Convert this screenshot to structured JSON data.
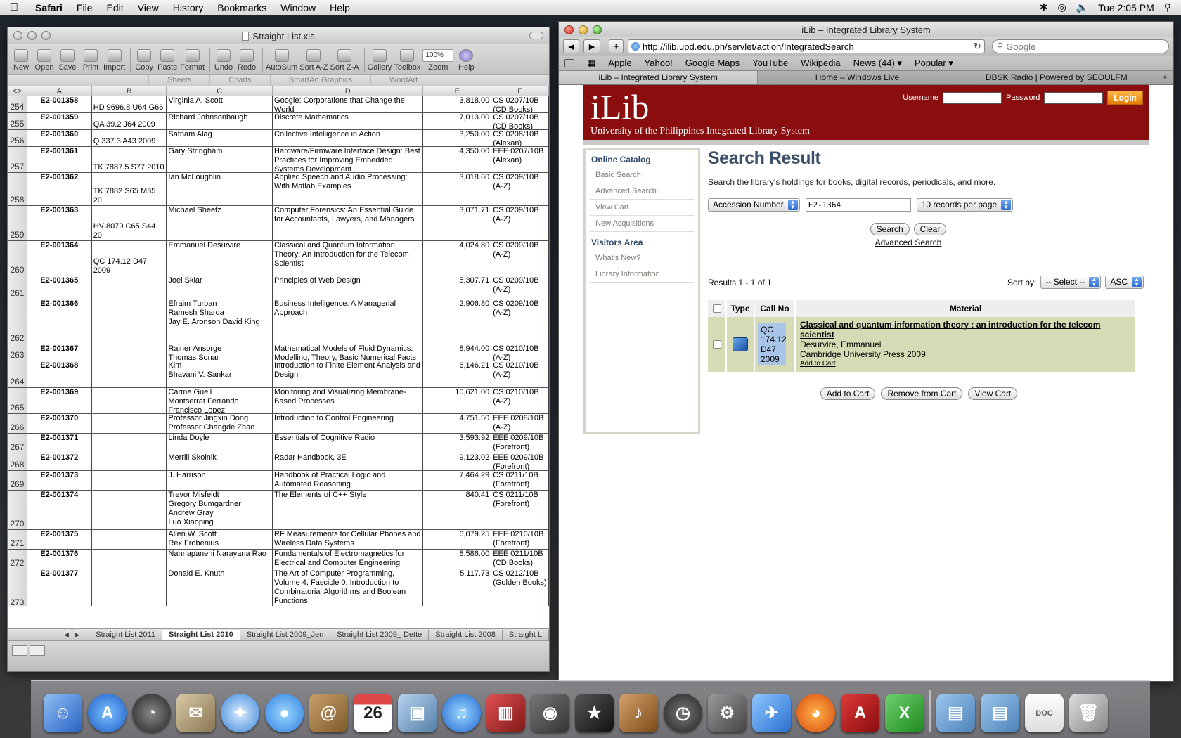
{
  "menubar": {
    "app": "Safari",
    "items": [
      "File",
      "Edit",
      "View",
      "History",
      "Bookmarks",
      "Window",
      "Help"
    ],
    "clock": "Tue 2:05 PM"
  },
  "excel": {
    "title": "Straight List.xls",
    "toolbar": [
      "New",
      "Open",
      "Save",
      "Print",
      "Import",
      "Copy",
      "Paste",
      "Format",
      "Undo",
      "Redo",
      "AutoSum",
      "Sort A-Z",
      "Sort Z-A",
      "Gallery",
      "Toolbox",
      "Zoom",
      "Help"
    ],
    "zoom_value": "100%",
    "ribbon": [
      "Sheets",
      "Charts",
      "SmartArt Graphics",
      "WordArt"
    ],
    "columns": [
      "A",
      "B",
      "C",
      "D",
      "E",
      "F"
    ],
    "rows": [
      {
        "n": "254",
        "a": "E2-001358",
        "b": "HD 9696.8 U64 G66",
        "c": "Virginia A. Scott",
        "d": "Google: Corporations that Change the World",
        "e": "3,818.00",
        "f": "CS 0207/10B (CD Books)"
      },
      {
        "n": "255",
        "a": "E2-001359",
        "b": "QA 39.2 J64 2009",
        "c": "Richard Johnsonbaugh",
        "d": "Discrete Mathematics",
        "e": "7,013.00",
        "f": "CS 0207/10B (CD Books)"
      },
      {
        "n": "256",
        "a": "E2-001360",
        "b": "Q 337.3 A43 2009",
        "c": "Satnam Alag",
        "d": "Collective Intelligence in Action",
        "e": "3,250.00",
        "f": "CS 0208/10B (Alexan)"
      },
      {
        "n": "257",
        "a": "E2-001361",
        "b": "TK 7887.5 S77 2010",
        "c": "Gary Stringham",
        "d": "Hardware/Firmware Interface Design: Best Practices for Improving Embedded Systems Development",
        "e": "4,350.00",
        "f": "EEE 0207/10B (Alexan)"
      },
      {
        "n": "258",
        "a": "E2-001362",
        "b": "TK 7882 S65 M35 20",
        "c": "Ian McLoughlin",
        "d": "Applied Speech and Audio Processing: With Matlab Examples",
        "e": "3,018.60",
        "f": "CS 0209/10B (A-Z)"
      },
      {
        "n": "259",
        "a": "E2-001363",
        "b": "HV 8079 C65 S44 20",
        "c": "Michael Sheetz",
        "d": "Computer Forensics: An Essential Guide for Accountants, Lawyers, and Managers",
        "e": "3,071.71",
        "f": "CS 0209/10B (A-Z)"
      },
      {
        "n": "260",
        "a": "E2-001364",
        "b": "QC 174.12 D47 2009",
        "c": "Emmanuel Desurvire",
        "d": "Classical and Quantum Information Theory: An Introduction for the Telecom Scientist",
        "e": "4,024.80",
        "f": "CS 0209/10B (A-Z)"
      },
      {
        "n": "261",
        "a": "E2-001365",
        "b": "",
        "c": "Joel Sklar",
        "d": "Principles of Web Design",
        "e": "5,307.71",
        "f": "CS 0209/10B (A-Z)"
      },
      {
        "n": "262",
        "a": "E2-001366",
        "b": "",
        "c": "Efraim Turban\nRamesh Sharda\nJay E. Aronson David King",
        "d": "Business Intelligence: A Managerial Approach",
        "e": "2,906.80",
        "f": "CS 0209/10B (A-Z)"
      },
      {
        "n": "263",
        "a": "E2-001367",
        "b": "",
        "c": "Rainer Ansorge\nThomas Sonar",
        "d": "Mathematical Models of Fluid Dynamics: Modelling, Theory, Basic Numerical Facts",
        "e": "8,944.00",
        "f": "CS 0210/10B (A-Z)"
      },
      {
        "n": "264",
        "a": "E2-001368",
        "b": "",
        "c": "Kim\nBhavani V. Sankar",
        "d": "Introduction to Finite Element Analysis and Design",
        "e": "6,146.21",
        "f": "CS 0210/10B (A-Z)"
      },
      {
        "n": "265",
        "a": "E2-001369",
        "b": "",
        "c": "Carme Guell\nMontserrat Ferrando\nFrancisco Lopez",
        "d": "Monitoring and Visualizing Membrane-Based Processes",
        "e": "10,621.00",
        "f": "CS 0210/10B (A-Z)"
      },
      {
        "n": "266",
        "a": "E2-001370",
        "b": "",
        "c": "Professor Jingxin Dong\nProfessor Changde Zhao",
        "d": "Introduction to Control Engineering",
        "e": "4,751.50",
        "f": "EEE 0208/10B (A-Z)"
      },
      {
        "n": "267",
        "a": "E2-001371",
        "b": "",
        "c": "Linda Doyle",
        "d": "Essentials of Cognitive Radio",
        "e": "3,593.92",
        "f": "EEE 0209/10B (Forefront)"
      },
      {
        "n": "268",
        "a": "E2-001372",
        "b": "",
        "c": "Merrill Skolnik",
        "d": "Radar Handbook, 3E",
        "e": "9,123.02",
        "f": "EEE 0209/10B (Forefront)"
      },
      {
        "n": "269",
        "a": "E2-001373",
        "b": "",
        "c": "J. Harrison",
        "d": "Handbook of Practical Logic and Automated Reasoning",
        "e": "7,464.29",
        "f": "CS 0211/10B (Forefront)"
      },
      {
        "n": "270",
        "a": "E2-001374",
        "b": "",
        "c": "Trevor Misfeldt\nGregory Bumgardner\nAndrew Gray\nLuo Xiaoping",
        "d": "The Elements of C++ Style",
        "e": "840.41",
        "f": "CS 0211/10B (Forefront)"
      },
      {
        "n": "271",
        "a": "E2-001375",
        "b": "",
        "c": "Allen W. Scott\nRex Frobenius",
        "d": "RF Measurements for Cellular Phones and Wireless Data Systems",
        "e": "6,079.25",
        "f": "EEE 0210/10B (Forefront)"
      },
      {
        "n": "272",
        "a": "E2-001376",
        "b": "",
        "c": "Nannapaneni Narayana Rao",
        "d": "Fundamentals of Electromagnetics for Electrical and Computer Engineering",
        "e": "8,586.00",
        "f": "EEE 0211/10B (CD Books)"
      },
      {
        "n": "273",
        "a": "E2-001377",
        "b": "",
        "c": "Donald E. Knuth",
        "d": "The Art of Computer Programming, Volume 4, Fascicle 0: Introduction to Combinatorial Algorithms and Boolean Functions",
        "e": "5,117.73",
        "f": "CS 0212/10B (Golden Books)"
      }
    ],
    "sheet_tabs": [
      "Straight List 2011",
      "Straight List 2010",
      "Straight List 2009_Jen",
      "Straight List 2009_ Dette",
      "Straight List 2008",
      "Straight L"
    ],
    "active_sheet": "Straight List 2010"
  },
  "safari": {
    "title": "iLib – Integrated Library System",
    "url": "http://ilib.upd.edu.ph/servlet/action/IntegratedSearch",
    "search_placeholder": "Google",
    "bookmarks": [
      "Apple",
      "Yahoo!",
      "Google Maps",
      "YouTube",
      "Wikipedia",
      "News (44) ▾",
      "Popular ▾"
    ],
    "tabs": [
      "iLib – Integrated Library System",
      "Home – Windows Live",
      "DBSK Radio | Powered by SEOULFM"
    ]
  },
  "ilib": {
    "logo": "iLib",
    "subtitle": "University of the Philippines Integrated Library System",
    "username_label": "Username",
    "password_label": "Password",
    "login_label": "Login",
    "sidebar": {
      "catalog_heading": "Online Catalog",
      "catalog_links": [
        "Basic Search",
        "Advanced Search",
        "View Cart",
        "New Acquisitions"
      ],
      "visitors_heading": "Visitors Area",
      "visitors_links": [
        "What's New?",
        "Library Information"
      ]
    },
    "heading": "Search Result",
    "description": "Search the library's holdings for books, digital records, periodicals, and more.",
    "search_field": "Accession Number",
    "search_value": "E2-1364",
    "per_page": "10 records per page",
    "search_btn": "Search",
    "clear_btn": "Clear",
    "advanced_link": "Advanced Search",
    "results_text": "Results 1 - 1 of 1",
    "sort_label": "Sort by:",
    "sort_select": "-- Select --",
    "sort_order": "ASC",
    "table_headers": [
      "Type",
      "Call No",
      "Material"
    ],
    "result": {
      "call_no": "QC 174.12 D47 2009",
      "title": "Classical and quantum information theory : an introduction for the telecom scientist",
      "author": "Desurvire, Emmanuel",
      "publisher": "Cambridge University Press 2009.",
      "add_to_cart": "Add to Cart"
    },
    "cart_buttons": [
      "Add to Cart",
      "Remove from Cart",
      "View Cart"
    ]
  }
}
